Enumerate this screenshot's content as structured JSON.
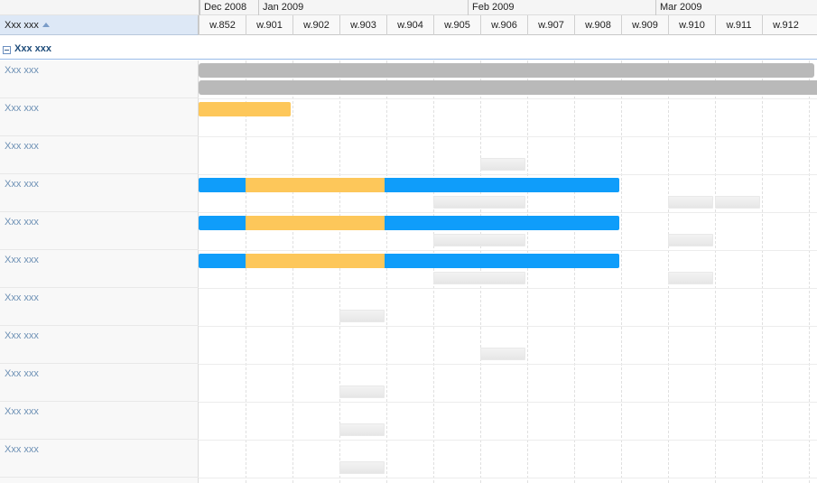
{
  "header": {
    "column_title": "Xxx xxx",
    "months": [
      "Dec 2008",
      "Jan 2009",
      "Feb 2009",
      "Mar 2009"
    ],
    "weeks": [
      "w.852",
      "w.901",
      "w.902",
      "w.903",
      "w.904",
      "w.905",
      "w.906",
      "w.907",
      "w.908",
      "w.909",
      "w.910",
      "w.911",
      "w.912"
    ]
  },
  "group": {
    "label": "Xxx xxx"
  },
  "rows": [
    {
      "label": "Xxx xxx"
    },
    {
      "label": "Xxx xxx"
    },
    {
      "label": "Xxx xxx"
    },
    {
      "label": "Xxx xxx"
    },
    {
      "label": "Xxx xxx"
    },
    {
      "label": "Xxx xxx"
    },
    {
      "label": "Xxx xxx"
    },
    {
      "label": "Xxx xxx"
    },
    {
      "label": "Xxx xxx"
    },
    {
      "label": "Xxx xxx"
    },
    {
      "label": "Xxx xxx"
    }
  ],
  "colors": {
    "gray_bar": "#b9b9b9",
    "yellow_bar": "#fdc75a",
    "blue_bar": "#0f9dfa",
    "header_selected": "#dde8f6",
    "row_label": "#6b8fb4",
    "group_label": "#1e4c7a"
  },
  "icons": {
    "group_toggle": "collapse-minus-icon",
    "sort": "sort-ascending-icon"
  }
}
